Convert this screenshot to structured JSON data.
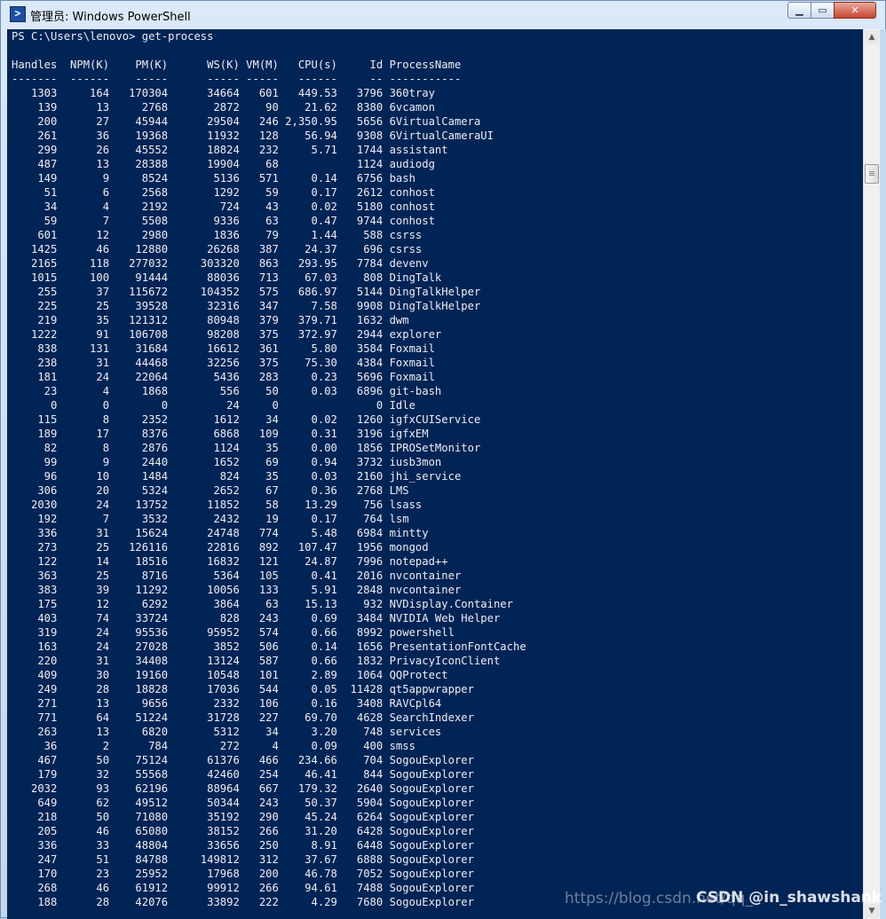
{
  "window": {
    "title": "管理员: Windows PowerShell"
  },
  "console": {
    "prompt": "PS C:\\Users\\lenovo> get-process",
    "header": "Handles  NPM(K)    PM(K)      WS(K) VM(M)   CPU(s)     Id ProcessName",
    "separator": "-------  ------    -----      ----- -----   ------     -- -----------",
    "rows": [
      "   1303     164   170304      34664   601   449.53   3796 360tray",
      "    139      13     2768       2872    90    21.62   8380 6vcamon",
      "    200      27    45944      29504   246 2,350.95   5656 6VirtualCamera",
      "    261      36    19368      11932   128    56.94   9308 6VirtualCameraUI",
      "    299      26    45552      18824   232     5.71   1744 assistant",
      "    487      13    28388      19904    68            1124 audiodg",
      "    149       9     8524       5136   571     0.14   6756 bash",
      "     51       6     2568       1292    59     0.17   2612 conhost",
      "     34       4     2192        724    43     0.02   5180 conhost",
      "     59       7     5508       9336    63     0.47   9744 conhost",
      "    601      12     2980       1836    79     1.44    588 csrss",
      "   1425      46    12880      26268   387    24.37    696 csrss",
      "   2165     118   277032     303320   863   293.95   7784 devenv",
      "   1015     100    91444      88036   713    67.03    808 DingTalk",
      "    255      37   115672     104352   575   686.97   5144 DingTalkHelper",
      "    225      25    39528      32316   347     7.58   9908 DingTalkHelper",
      "    219      35   121312      80948   379   379.71   1632 dwm",
      "   1222      91   106708      98208   375   372.97   2944 explorer",
      "    838     131    31684      16612   361     5.80   3584 Foxmail",
      "    238      31    44468      32256   375    75.30   4384 Foxmail",
      "    181      24    22064       5436   283     0.23   5696 Foxmail",
      "     23       4     1868        556    50     0.03   6896 git-bash",
      "      0       0        0         24     0               0 Idle",
      "    115       8     2352       1612    34     0.02   1260 igfxCUIService",
      "    189      17     8376       6868   109     0.31   3196 igfxEM",
      "     82       8     2876       1124    35     0.00   1856 IPROSetMonitor",
      "     99       9     2440       1652    69     0.94   3732 iusb3mon",
      "     96      10     1484        824    35     0.03   2160 jhi_service",
      "    306      20     5324       2652    67     0.36   2768 LMS",
      "   2030      24    13752      11852    58    13.29    756 lsass",
      "    192       7     3532       2432    19     0.17    764 lsm",
      "    336      31    15624      24748   774     5.48   6984 mintty",
      "    273      25   126116      22816   892   107.47   1956 mongod",
      "    122      14    18516      16832   121    24.87   7996 notepad++",
      "    363      25     8716       5364   105     0.41   2016 nvcontainer",
      "    383      39    11292      10056   133     5.91   2848 nvcontainer",
      "    175      12     6292       3864    63    15.13    932 NVDisplay.Container",
      "    403      74    33724        828   243     0.69   3484 NVIDIA Web Helper",
      "    319      24    95536      95952   574     0.66   8992 powershell",
      "    163      24    27028       3852   506     0.14   1656 PresentationFontCache",
      "    220      31    34408      13124   587     0.66   1832 PrivacyIconClient",
      "    409      30    19160      10548   101     2.89   1064 QQProtect",
      "    249      28    18828      17036   544     0.05  11428 qt5appwrapper",
      "    271      13     9656       2332   106     0.16   3408 RAVCpl64",
      "    771      64    51224      31728   227    69.70   4628 SearchIndexer",
      "    263      13     6820       5312    34     3.20    748 services",
      "     36       2      784        272     4     0.09    400 smss",
      "    467      50    75124      61376   466   234.66    704 SogouExplorer",
      "    179      32    55568      42460   254    46.41    844 SogouExplorer",
      "   2032      93    62196      88964   667   179.32   2640 SogouExplorer",
      "    649      62    49512      50344   243    50.37   5904 SogouExplorer",
      "    218      50    71080      35192   290    45.24   6264 SogouExplorer",
      "    205      46    65080      38152   266    31.20   6428 SogouExplorer",
      "    336      33    48804      33656   250     8.91   6448 SogouExplorer",
      "    247      51    84788     149812   312    37.67   6888 SogouExplorer",
      "    170      23    25952      17968   200    46.78   7052 SogouExplorer",
      "    268      46    61912      99912   266    94.61   7488 SogouExplorer",
      "    188      28    42076      33892   222     4.29   7680 SogouExplorer"
    ]
  },
  "watermark": {
    "url": "https://blog.csdn.net/qq_",
    "brand": "CSDN @in_shawshank"
  },
  "icons": {
    "app": "powershell-icon",
    "minimize": "minimize-icon",
    "maximize": "maximize-icon",
    "close": "close-icon"
  },
  "colors": {
    "console_bg": "#012456",
    "console_text": "#eeedf0"
  }
}
